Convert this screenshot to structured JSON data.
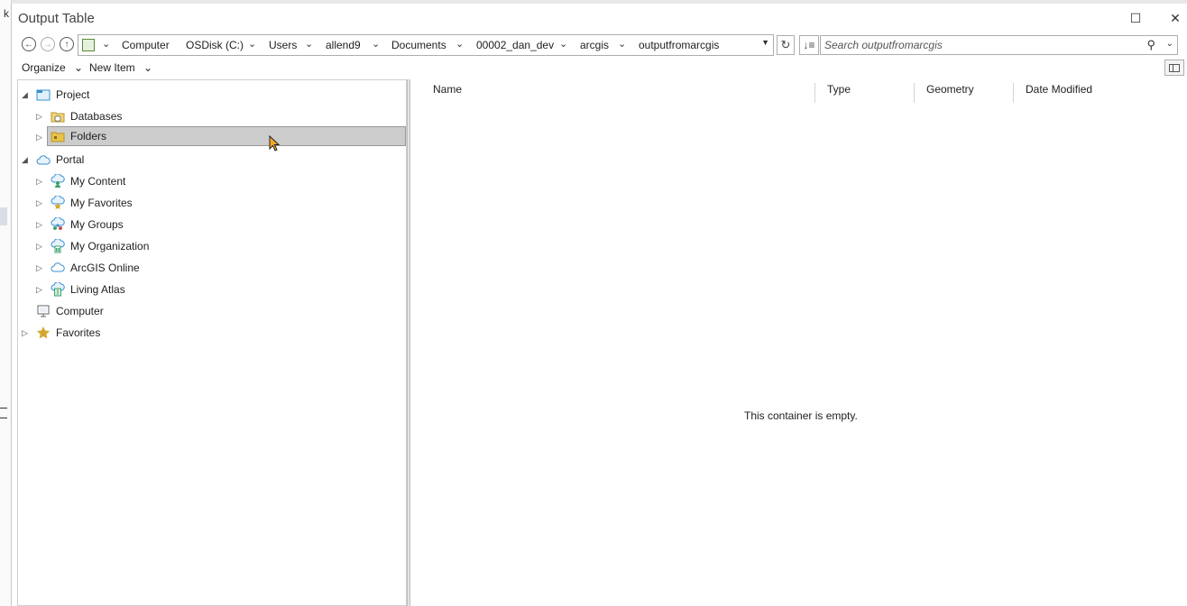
{
  "background": {
    "left_char": "k"
  },
  "window": {
    "title": "Output Table",
    "maximize_glyph": "☐",
    "close_glyph": "✕"
  },
  "navigation": {
    "back_glyph": "←",
    "forward_glyph": "→",
    "up_glyph": "↑",
    "breadcrumbs": [
      "Computer",
      "OSDisk (C:)",
      "Users",
      "allend9",
      "Documents",
      "00002_dan_dev",
      "arcgis",
      "outputfromarcgis"
    ],
    "chevron": "⌄",
    "refresh_glyph": "↻",
    "sort_glyph": "↓≡"
  },
  "search": {
    "placeholder": "Search outputfromarcgis",
    "value": "",
    "icon_glyph": "⚲"
  },
  "toolbar": {
    "organize_label": "Organize",
    "new_item_label": "New Item",
    "dropdown_glyph": "⌄"
  },
  "tree": {
    "nodes": [
      {
        "label": "Project",
        "icon": "project-icon",
        "level": 0,
        "expanded": true
      },
      {
        "label": "Databases",
        "icon": "databases-icon",
        "level": 1,
        "expanded": false
      },
      {
        "label": "Folders",
        "icon": "folders-icon",
        "level": 1,
        "expanded": false,
        "selected": true
      },
      {
        "label": "Portal",
        "icon": "portal-icon",
        "level": 0,
        "expanded": true
      },
      {
        "label": "My Content",
        "icon": "my-content-icon",
        "level": 1,
        "expanded": false
      },
      {
        "label": "My Favorites",
        "icon": "my-favorites-icon",
        "level": 1,
        "expanded": false
      },
      {
        "label": "My Groups",
        "icon": "my-groups-icon",
        "level": 1,
        "expanded": false
      },
      {
        "label": "My Organization",
        "icon": "my-organization-icon",
        "level": 1,
        "expanded": false
      },
      {
        "label": "ArcGIS Online",
        "icon": "arcgis-online-icon",
        "level": 1,
        "expanded": false
      },
      {
        "label": "Living Atlas",
        "icon": "living-atlas-icon",
        "level": 1,
        "expanded": false
      },
      {
        "label": "Computer",
        "icon": "computer-icon",
        "level": 0,
        "expanded": null
      },
      {
        "label": "Favorites",
        "icon": "favorites-star-icon",
        "level": 0,
        "expanded": false
      }
    ]
  },
  "content": {
    "columns": [
      "Name",
      "Type",
      "Geometry",
      "Date Modified"
    ],
    "empty_message": "This container is empty."
  },
  "colors": {
    "selection": "#cccccc",
    "folder": "#e8c34a",
    "portal_blue": "#3a8fd0",
    "portal_green": "#3aa06a",
    "star": "#d4a72c"
  }
}
